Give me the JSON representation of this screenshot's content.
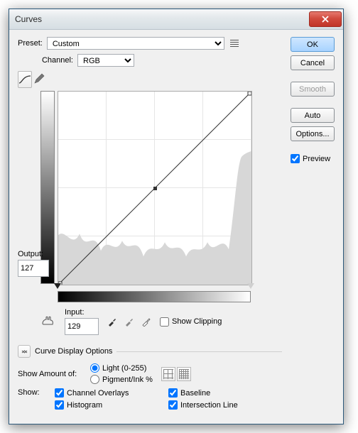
{
  "title": "Curves",
  "preset": {
    "label": "Preset:",
    "value": "Custom"
  },
  "channel": {
    "label": "Channel:",
    "value": "RGB"
  },
  "output": {
    "label": "Output:",
    "value": "127"
  },
  "input": {
    "label": "Input:",
    "value": "129"
  },
  "show_clipping": {
    "label": "Show Clipping",
    "checked": false
  },
  "buttons": {
    "ok": "OK",
    "cancel": "Cancel",
    "smooth": "Smooth",
    "auto": "Auto",
    "options": "Options..."
  },
  "preview": {
    "label": "Preview",
    "checked": true
  },
  "display_options": {
    "header": "Curve Display Options",
    "show_amount_label": "Show Amount of:",
    "light": {
      "label": "Light  (0-255)",
      "checked": true
    },
    "pigment": {
      "label": "Pigment/Ink %",
      "checked": false
    },
    "show_label": "Show:",
    "channel_overlays": {
      "label": "Channel Overlays",
      "checked": true
    },
    "baseline": {
      "label": "Baseline",
      "checked": true
    },
    "histogram": {
      "label": "Histogram",
      "checked": true
    },
    "intersection": {
      "label": "Intersection Line",
      "checked": true
    }
  }
}
